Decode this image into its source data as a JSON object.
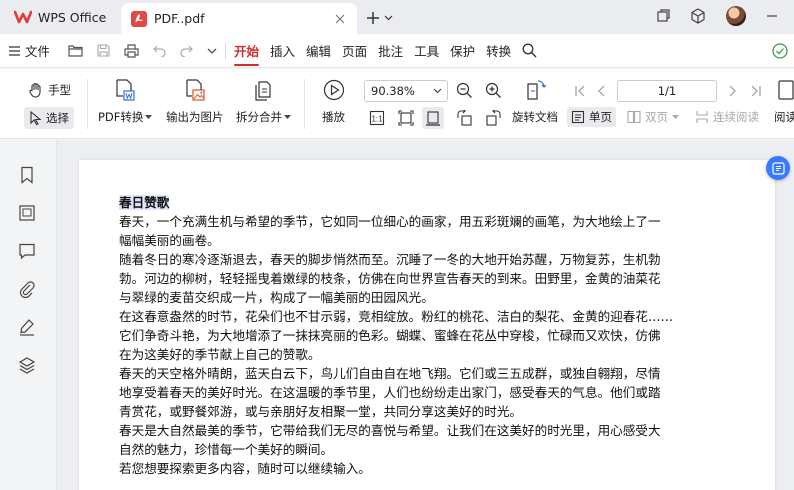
{
  "titlebar": {
    "app_tab": "WPS Office",
    "doc_tab": "PDF..pdf"
  },
  "menubar": {
    "file_label": "文件",
    "tabs": [
      "开始",
      "插入",
      "编辑",
      "页面",
      "批注",
      "工具",
      "保护",
      "转换"
    ],
    "active_tab": "开始"
  },
  "ribbon": {
    "hand": "手型",
    "select": "选择",
    "pdf_convert": "PDF转换",
    "export_image": "输出为图片",
    "split_merge": "拆分合并",
    "play": "播放",
    "zoom": "90.38%",
    "rotate_doc": "旋转文档",
    "page_indicator": "1/1",
    "single_page": "单页",
    "double_page": "双页",
    "continuous": "连续阅读",
    "reading_mode": "阅读"
  },
  "document": {
    "title": "春日赞歌",
    "lines": [
      "春天，一个充满生机与希望的季节，它如同一位细心的画家，用五彩斑斓的画笔，为大地绘上了一",
      "幅幅美丽的画卷。",
      "随着冬日的寒冷逐渐退去，春天的脚步悄然而至。沉睡了一冬的大地开始苏醒，万物复苏，生机勃",
      "勃。河边的柳树，轻轻摇曳着嫩绿的枝条，仿佛在向世界宣告春天的到来。田野里，金黄的油菜花",
      "与翠绿的麦苗交织成一片，构成了一幅美丽的田园风光。",
      "在这春意盎然的时节，花朵们也不甘示弱，竞相绽放。粉红的桃花、洁白的梨花、金黄的迎春花……",
      "它们争奇斗艳，为大地增添了一抹抹亮丽的色彩。蝴蝶、蜜蜂在花丛中穿梭，忙碌而又欢快，仿佛",
      "在为这美好的季节献上自己的赞歌。",
      "春天的天空格外晴朗，蓝天白云下，鸟儿们自由自在地飞翔。它们或三五成群，或独自翱翔，尽情",
      "地享受着春天的美好时光。在这温暖的季节里，人们也纷纷走出家门，感受春天的气息。他们或踏",
      "青赏花，或野餐郊游，或与亲朋好友相聚一堂，共同分享这美好的时光。",
      "春天是大自然最美的季节，它带给我们无尽的喜悦与希望。让我们在这美好的时光里，用心感受大",
      "自然的魅力，珍惜每一个美好的瞬间。",
      "若您想要探索更多内容，随时可以继续输入。"
    ]
  },
  "colors": {
    "accent": "#d12f2f",
    "brand_blue": "#3a7afe",
    "wps_logo": "#e23b3b"
  }
}
